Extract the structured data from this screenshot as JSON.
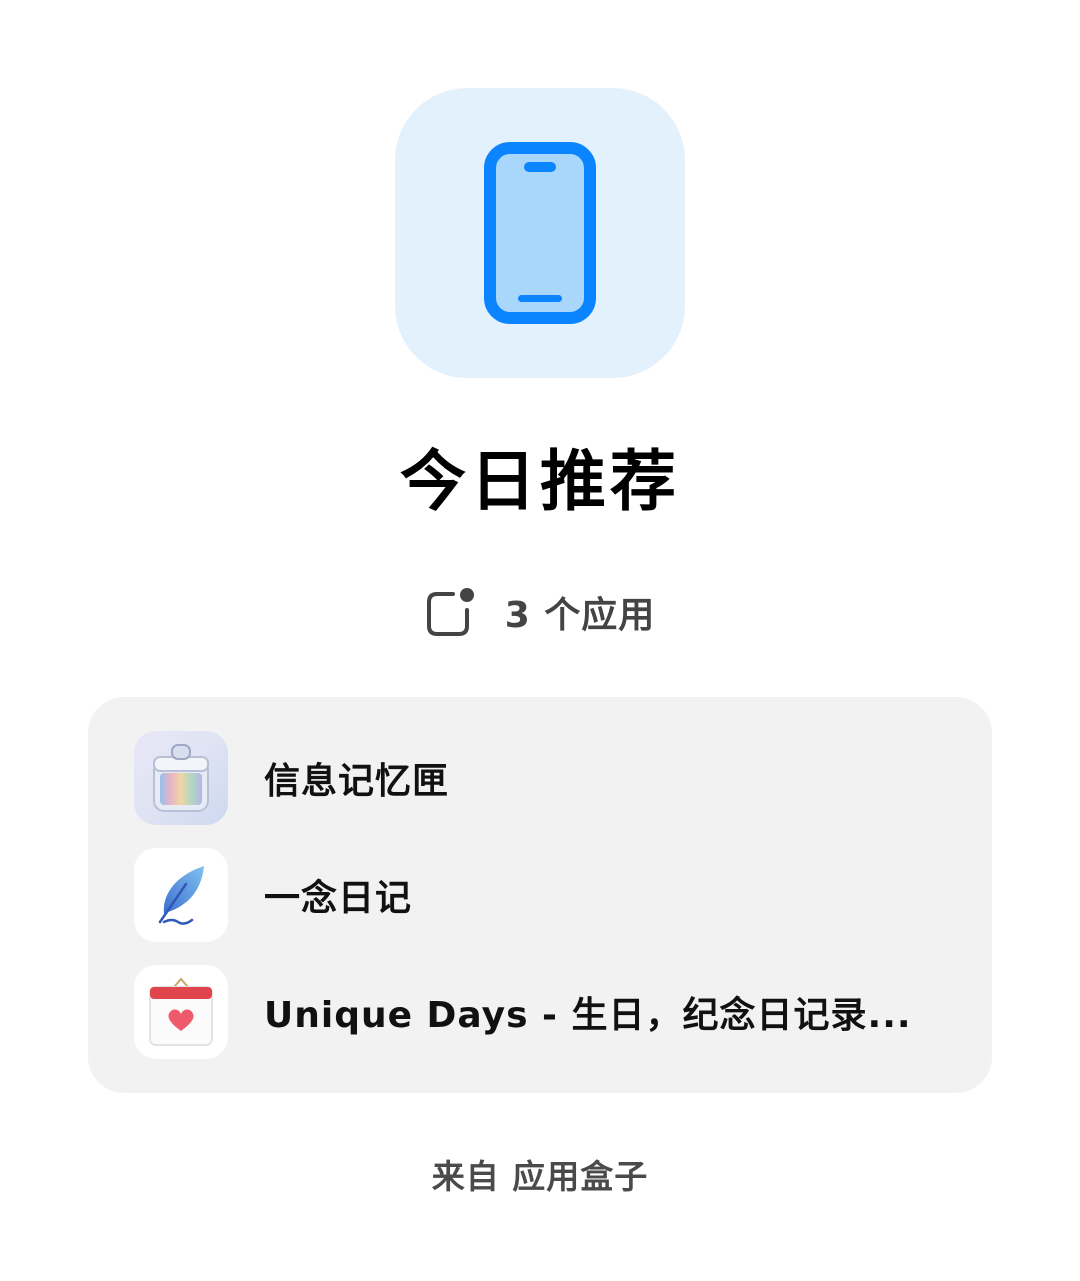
{
  "header": {
    "icon": "smartphone-icon",
    "accent_color": "#0a84ff",
    "icon_bg_color": "#e3f1fd",
    "title": "今日推荐"
  },
  "summary": {
    "icon": "app-badge-icon",
    "count_text": "3 个应用"
  },
  "apps": [
    {
      "name": "信息记忆匣",
      "icon": "memory-box-icon"
    },
    {
      "name": "一念日记",
      "icon": "feather-pen-icon"
    },
    {
      "name": "Unique Days - 生日，纪念日记录...",
      "icon": "heart-calendar-icon"
    }
  ],
  "footer": {
    "source_text": "来自 应用盒子"
  }
}
